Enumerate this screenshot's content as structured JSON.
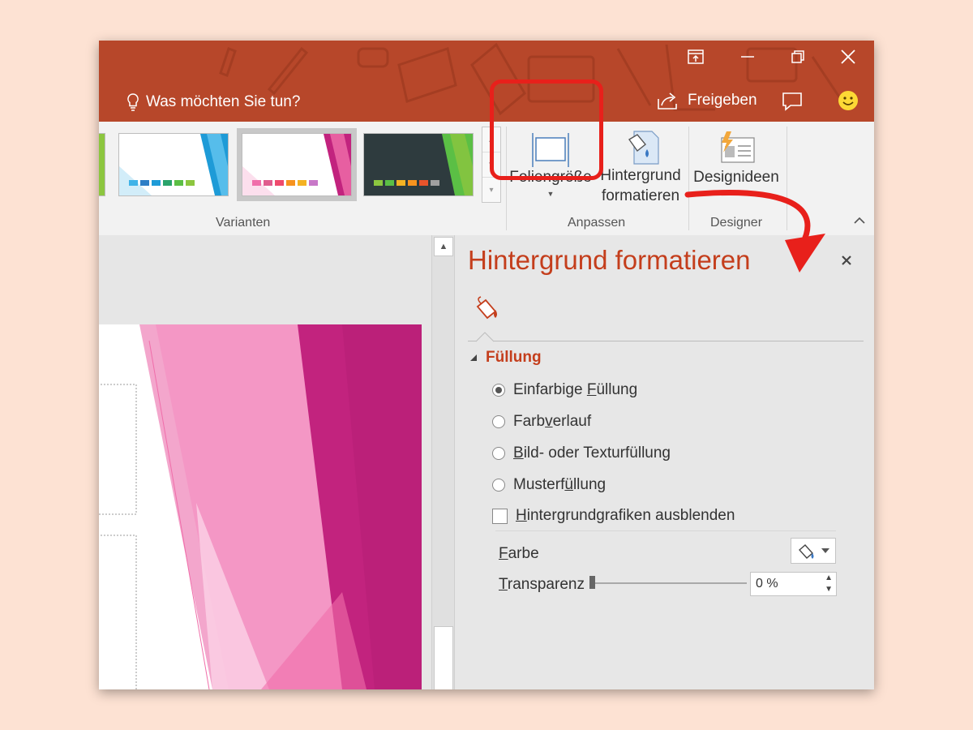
{
  "titlebar": {
    "tell_me": "Was möchten Sie tun?",
    "share": "Freigeben",
    "icons": [
      "ribbon-display-icon",
      "minimize-icon",
      "restore-icon",
      "close-icon",
      "lightbulb-icon",
      "share-icon",
      "comment-icon",
      "smiley-icon"
    ]
  },
  "ribbon": {
    "groups": {
      "variants": "Varianten",
      "customize": "Anpassen",
      "designer": "Designer"
    },
    "buttons": {
      "slide_size": "Foliengröße",
      "format_bg_line1": "Hintergrund",
      "format_bg_line2": "formatieren",
      "design_ideas": "Designideen"
    },
    "variant_colors": {
      "blue": [
        "#3fb3e8",
        "#2d7ec6",
        "#1e9bd7",
        "#2aa36b",
        "#5bbf45",
        "#8cc63f"
      ],
      "pink": [
        "#f06eaa",
        "#e05c8e",
        "#ef4a6d",
        "#f7931e",
        "#f4b223",
        "#c878c8"
      ],
      "dark": [
        "#8cc63f",
        "#5bbf45",
        "#f4b223",
        "#f7931e",
        "#e8542b",
        "#a0a0a0"
      ]
    }
  },
  "pane": {
    "title": "Hintergrund formatieren",
    "section": "Füllung",
    "options": {
      "solid_a": "Einfarbige ",
      "solid_u": "F",
      "solid_b": "üllung",
      "gradient_a": "Farb",
      "gradient_u": "v",
      "gradient_b": "erlauf",
      "picture_u": "B",
      "picture_b": "ild- oder Texturfüllung",
      "pattern_a": "Musterf",
      "pattern_u": "ü",
      "pattern_b": "llung",
      "hide_a": "",
      "hide_u": "H",
      "hide_b": "intergrundgrafiken ausblenden"
    },
    "color_u": "F",
    "color_b": "arbe",
    "transparency_u": "T",
    "transparency_b": "ransparenz",
    "transparency_value": "0 %",
    "transparency_level": 0
  }
}
